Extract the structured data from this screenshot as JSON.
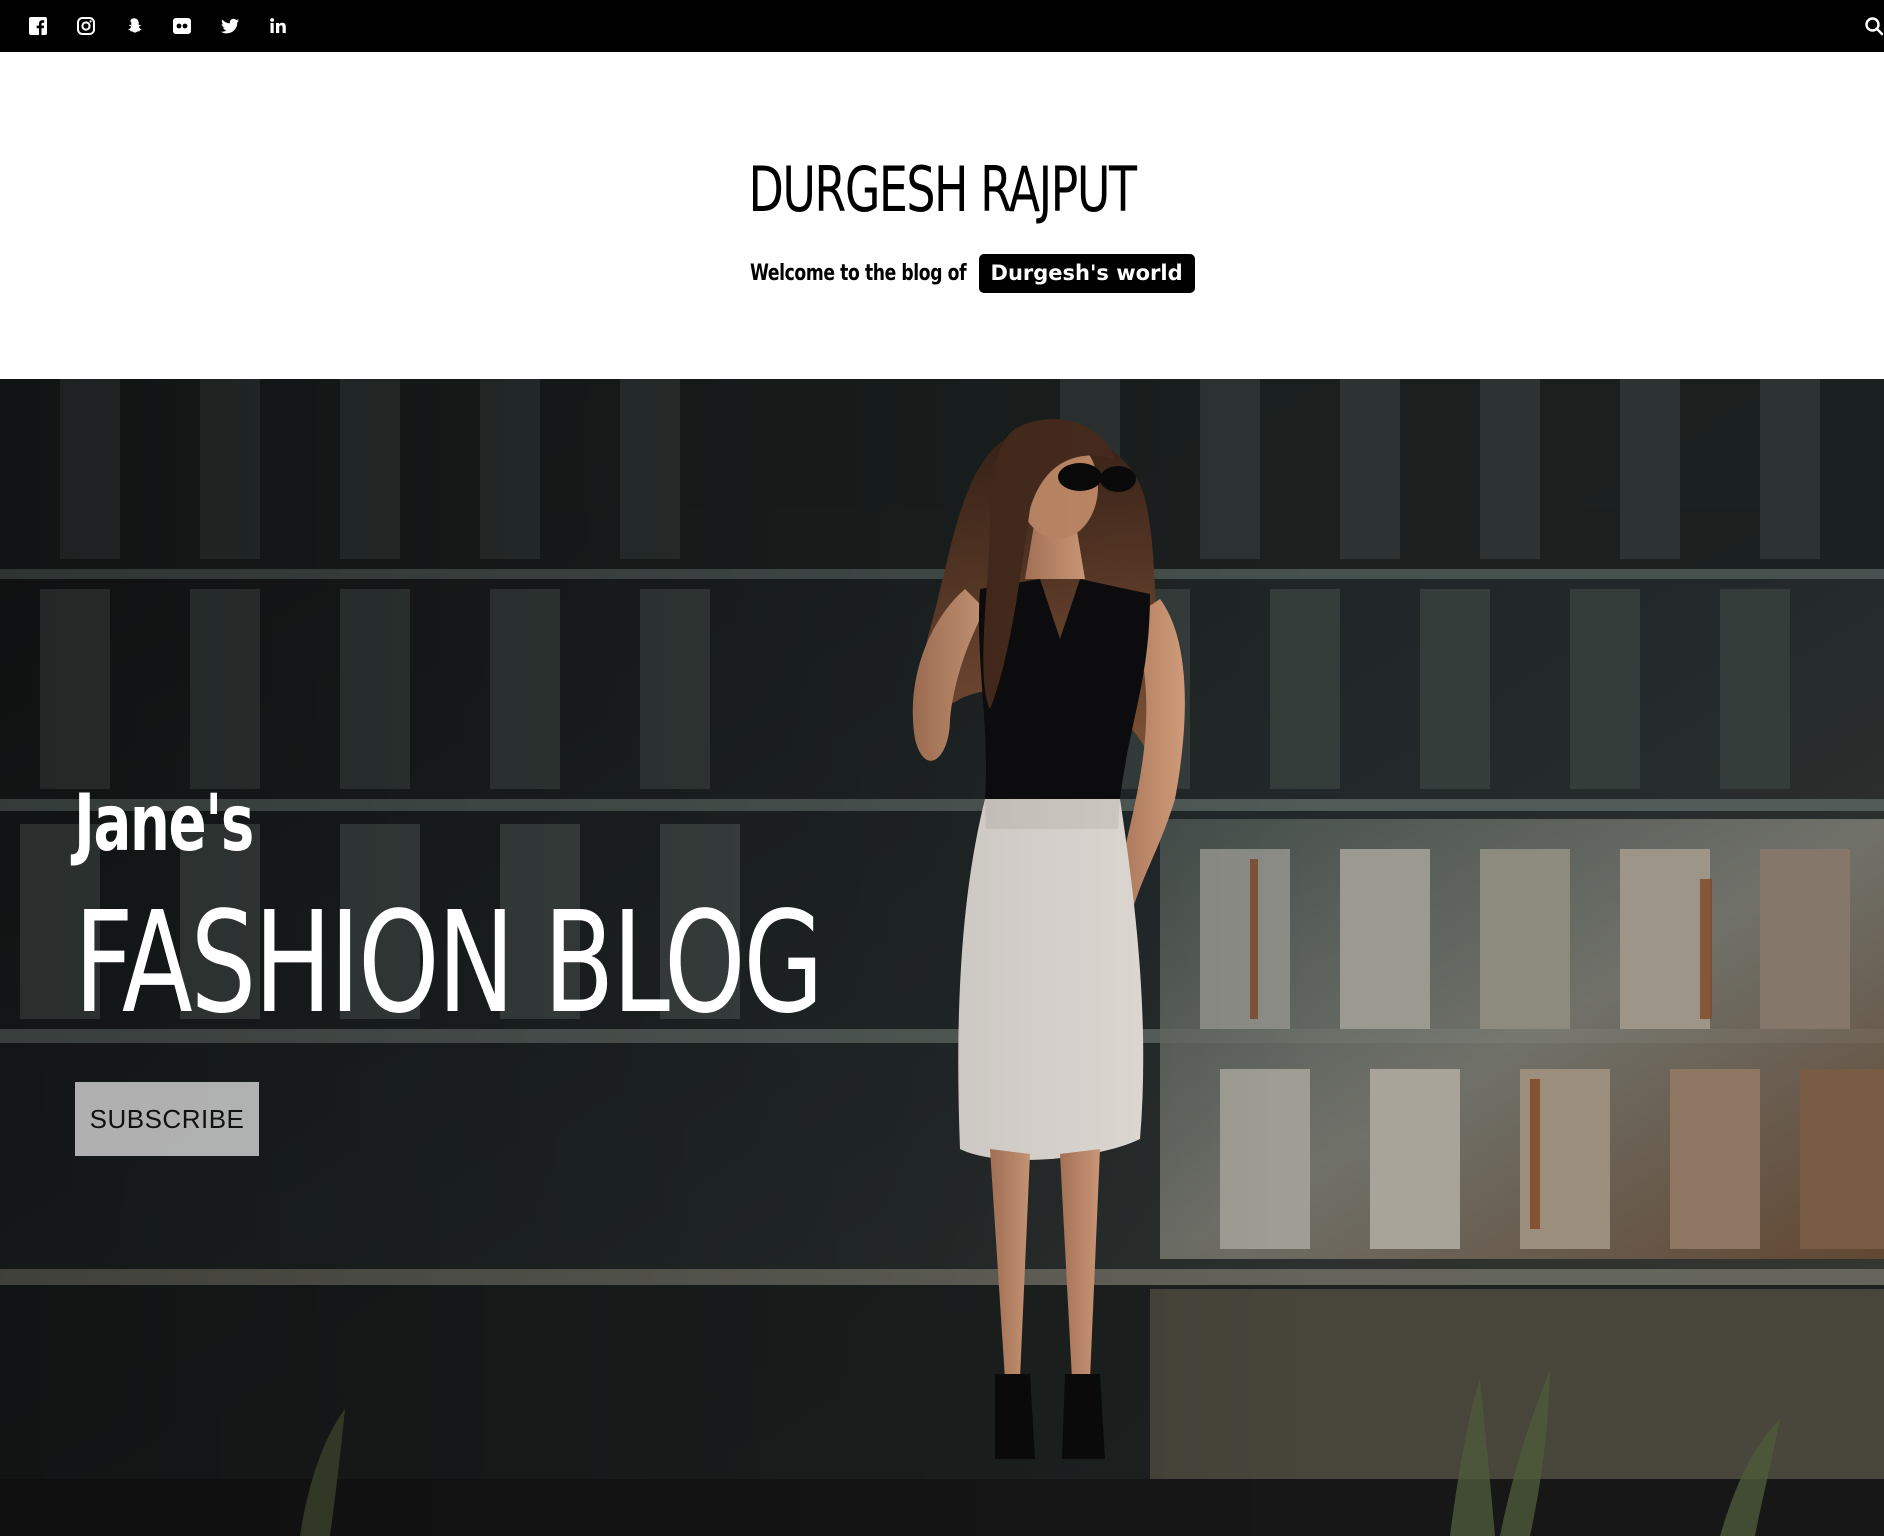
{
  "social": {
    "icons": [
      "facebook-icon",
      "instagram-icon",
      "snapchat-icon",
      "flickr-icon",
      "twitter-icon",
      "linkedin-icon"
    ],
    "search_icon": "search-icon"
  },
  "header": {
    "site_title": "DURGESH RAJPUT",
    "tagline_text": "Welcome to the blog of",
    "tagline_badge": "Durgesh's world"
  },
  "hero": {
    "subtitle": "Jane's",
    "title": "FASHION BLOG",
    "subscribe_label": "SUBSCRIBE",
    "image": "photo of woman in black top and white pencil skirt posing in front of rusted industrial metal structures"
  },
  "colors": {
    "topbar": "#000000",
    "badge_bg": "#000000",
    "hero_text": "#ffffff",
    "subscribe_bg": "#bebebe"
  }
}
